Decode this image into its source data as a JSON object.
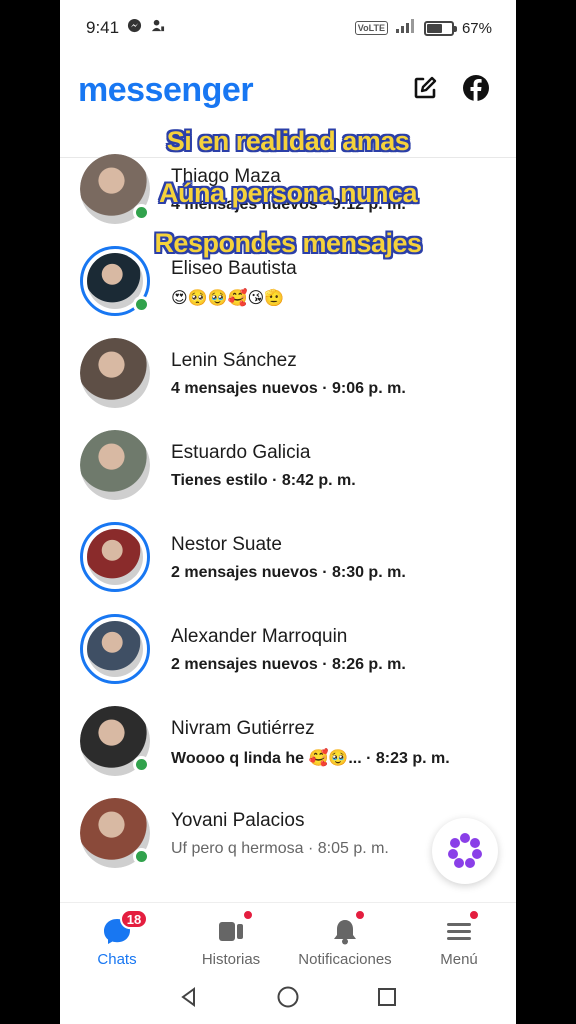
{
  "status_bar": {
    "time": "9:41",
    "network": "VoLTE",
    "battery_percent": "67%",
    "battery_level": 0.67
  },
  "header": {
    "brand": "messenger",
    "compose_icon": "compose-icon",
    "facebook_icon": "facebook-icon"
  },
  "caption": {
    "line1": "Si en realidad amas",
    "line2": "Aúna persona nunca",
    "line3": "Respondes mensajes"
  },
  "chats": [
    {
      "name": "Thiago Maza",
      "sub": "4 mensajes nuevos · 9:12 p. m.",
      "online": true,
      "ring": false,
      "unread": true,
      "color": "#7a6a60"
    },
    {
      "name": "Eliseo Bautista",
      "sub": "😍🥺🥹🥰😘🫡",
      "online": true,
      "ring": true,
      "unread": true,
      "color": "#1b2a35"
    },
    {
      "name": "Lenin Sánchez",
      "sub": "4 mensajes nuevos · 9:06 p. m.",
      "online": false,
      "ring": false,
      "unread": true,
      "color": "#5e4f46"
    },
    {
      "name": "Estuardo Galicia",
      "sub": "Tienes estilo · 8:42 p. m.",
      "online": false,
      "ring": false,
      "unread": true,
      "color": "#6f7a6c"
    },
    {
      "name": "Nestor Suate",
      "sub": "2 mensajes nuevos · 8:30 p. m.",
      "online": false,
      "ring": true,
      "unread": true,
      "color": "#8a2b2b"
    },
    {
      "name": "Alexander Marroquin",
      "sub": "2 mensajes nuevos · 8:26 p. m.",
      "online": false,
      "ring": true,
      "unread": true,
      "color": "#3f4f64"
    },
    {
      "name": "Nivram Gutiérrez",
      "sub": "Woooo q linda he 🥰🥹... · 8:23 p. m.",
      "online": true,
      "ring": false,
      "unread": true,
      "color": "#2c2c2c"
    },
    {
      "name": "Yovani Palacios",
      "sub": "Uf pero q hermosa · 8:05 p. m.",
      "online": true,
      "ring": false,
      "unread": false,
      "color": "#8a4a3a"
    }
  ],
  "bottom_nav": {
    "chats_label": "Chats",
    "chats_badge": "18",
    "stories_label": "Historias",
    "notifications_label": "Notificaciones",
    "menu_label": "Menú"
  },
  "colors": {
    "brand": "#1877f2",
    "online": "#31a24c",
    "badge": "#e41e3f"
  }
}
